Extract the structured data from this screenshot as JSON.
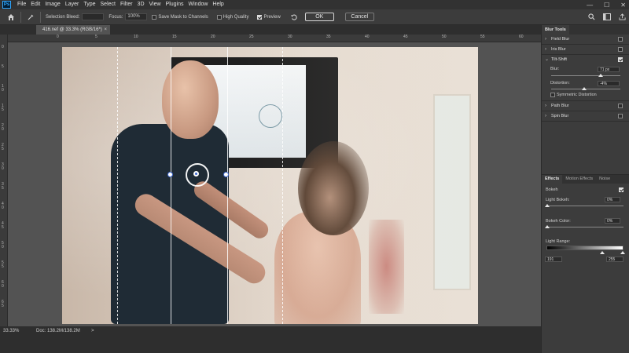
{
  "menu": {
    "logo": "Ps",
    "items": [
      "File",
      "Edit",
      "Image",
      "Layer",
      "Type",
      "Select",
      "Filter",
      "3D",
      "View",
      "Plugins",
      "Window",
      "Help"
    ]
  },
  "window_controls": [
    "—",
    "☐",
    "✕"
  ],
  "options": {
    "selection_bleed_label": "Selection Bleed:",
    "focus_label": "Focus:",
    "focus_value": "100%",
    "save_mask_label": "Save Mask to Channels",
    "save_mask_checked": false,
    "high_quality_label": "High Quality",
    "high_quality_checked": false,
    "preview_label": "Preview",
    "preview_checked": true,
    "ok_label": "OK",
    "cancel_label": "Cancel"
  },
  "document": {
    "tab_title": "416.nef @ 33.3% (RGB/16*)",
    "close": "×"
  },
  "ruler_top_labels": [
    "0",
    "5",
    "10",
    "15",
    "20",
    "25",
    "30",
    "35",
    "40",
    "45",
    "50",
    "55",
    "60"
  ],
  "ruler_left_labels": [
    "0",
    "5",
    "1\n0",
    "1\n5",
    "2\n0",
    "2\n5",
    "3\n0",
    "3\n5",
    "4\n0",
    "4\n5",
    "5\n0",
    "5\n5",
    "6\n0",
    "6\n5"
  ],
  "status": {
    "zoom": "33.33%",
    "doc": "Doc: 138.2M/138.2M",
    "arrow": ">"
  },
  "panel": {
    "tab_label": "Blur Tools",
    "field_blur": {
      "label": "Field Blur",
      "checked": false
    },
    "iris_blur": {
      "label": "Iris Blur",
      "checked": false
    },
    "tilt_shift": {
      "label": "Tilt-Shift",
      "checked": true,
      "blur_label": "Blur:",
      "blur_value": "71 px",
      "blur_level": 0.72,
      "distortion_label": "Distortion:",
      "distortion_value": "-4%",
      "distortion_level": 0.48,
      "symmetric_label": "Symmetric Distortion",
      "symmetric_checked": false
    },
    "path_blur": {
      "label": "Path Blur",
      "checked": false
    },
    "spin_blur": {
      "label": "Spin Blur",
      "checked": false
    },
    "effects_tabs": [
      "Effects",
      "Motion Effects",
      "Noise"
    ],
    "bokeh": {
      "label": "Bokeh",
      "checked": true,
      "light_bokeh_label": "Light Bokeh:",
      "light_bokeh_value": "0%",
      "bokeh_color_label": "Bokeh Color:",
      "bokeh_color_value": "0%",
      "light_range_label": "Light Range:",
      "range_low": "191",
      "range_high": "255"
    }
  }
}
